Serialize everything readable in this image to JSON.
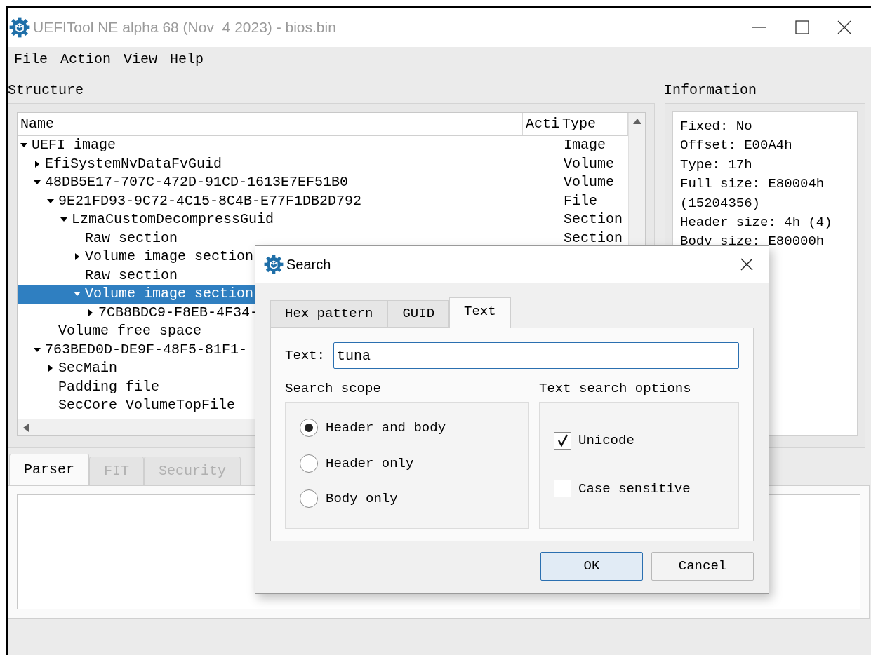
{
  "window": {
    "title": "UEFITool NE alpha 68 (Nov  4 2023) - bios.bin"
  },
  "menu": [
    {
      "label": "File"
    },
    {
      "label": "Action"
    },
    {
      "label": "View"
    },
    {
      "label": "Help"
    }
  ],
  "structure": {
    "title": "Structure",
    "columns": [
      "Name",
      "Acti",
      "Type"
    ],
    "tree": [
      {
        "name": "UEFI image",
        "type": "Image",
        "expanded": true,
        "selected": false,
        "children": [
          {
            "name": "EfiSystemNvDataFvGuid",
            "type": "Volume",
            "expanded": false,
            "selected": false
          },
          {
            "name": "48DB5E17-707C-472D-91CD-1613E7EF51B0",
            "type": "Volume",
            "expanded": true,
            "selected": false,
            "children": [
              {
                "name": "9E21FD93-9C72-4C15-8C4B-E77F1DB2D792",
                "type": "File",
                "expanded": true,
                "selected": false,
                "children": [
                  {
                    "name": "LzmaCustomDecompressGuid",
                    "type": "Section",
                    "expanded": true,
                    "selected": false,
                    "children": [
                      {
                        "name": "Raw section",
                        "type": "Section",
                        "selected": false
                      },
                      {
                        "name": "Volume image section",
                        "expanded": false,
                        "selected": false
                      },
                      {
                        "name": "Raw section",
                        "selected": false
                      },
                      {
                        "name": "Volume image section",
                        "expanded": true,
                        "selected": true,
                        "children": [
                          {
                            "name": "7CB8BDC9-F8EB-4F34-",
                            "expanded": false,
                            "selected": false
                          }
                        ]
                      }
                    ]
                  }
                ]
              },
              {
                "name": "Volume free space",
                "selected": false
              }
            ]
          },
          {
            "name": "763BED0D-DE9F-48F5-81F1-",
            "expanded": true,
            "selected": false,
            "children": [
              {
                "name": "SecMain",
                "expanded": false,
                "selected": false
              },
              {
                "name": "Padding file",
                "selected": false
              },
              {
                "name": "SecCore VolumeTopFile",
                "selected": false
              }
            ]
          }
        ]
      }
    ]
  },
  "information": {
    "title": "Information",
    "lines": [
      "Fixed: No",
      "Offset: E00A4h",
      "Type: 17h",
      "Full size: E80004h",
      "(15204356)",
      "Header size: 4h (4)",
      "Body size: E80000h"
    ]
  },
  "bottom_tabs": [
    {
      "label": "Parser",
      "selected": true,
      "disabled": false
    },
    {
      "label": "FIT",
      "selected": false,
      "disabled": true
    },
    {
      "label": "Security",
      "selected": false,
      "disabled": true
    }
  ],
  "dialog": {
    "title": "Search",
    "tabs": [
      {
        "label": "Hex pattern",
        "selected": false
      },
      {
        "label": "GUID",
        "selected": false
      },
      {
        "label": "Text",
        "selected": true
      }
    ],
    "text_field": {
      "label": "Text:",
      "value": "tuna"
    },
    "scope": {
      "title": "Search scope",
      "options": [
        {
          "label": "Header and body",
          "selected": true
        },
        {
          "label": "Header only",
          "selected": false
        },
        {
          "label": "Body only",
          "selected": false
        }
      ]
    },
    "options": {
      "title": "Text search options",
      "items": [
        {
          "label": "Unicode",
          "checked": true
        },
        {
          "label": "Case sensitive",
          "checked": false
        }
      ]
    },
    "buttons": [
      {
        "label": "OK",
        "default": true
      },
      {
        "label": "Cancel",
        "default": false
      }
    ]
  }
}
